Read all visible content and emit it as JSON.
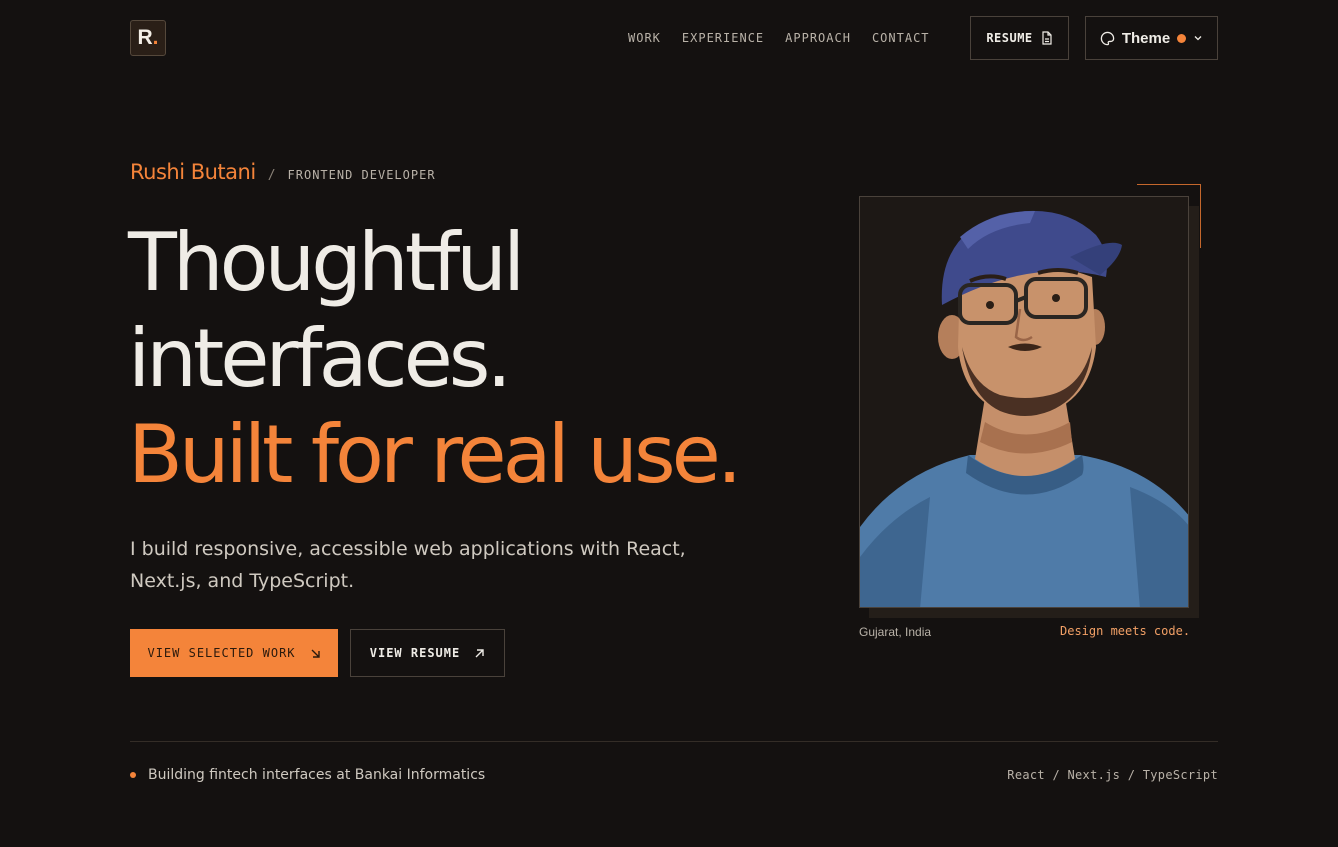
{
  "colors": {
    "accent": "#f4843a",
    "background": "#141110",
    "text": "#efece6"
  },
  "header": {
    "logo": {
      "letter": "R",
      "dot": "."
    },
    "nav": [
      {
        "label": "WORK"
      },
      {
        "label": "EXPERIENCE"
      },
      {
        "label": "APPROACH"
      },
      {
        "label": "CONTACT"
      }
    ],
    "resume_button": {
      "label": "RESUME",
      "icon": "document-icon"
    },
    "theme_button": {
      "label": "Theme",
      "icon": "palette-icon"
    }
  },
  "hero": {
    "name": "Rushi Butani",
    "separator": "/",
    "role": "FRONTEND DEVELOPER",
    "headline": {
      "line1": "Thoughtful",
      "line2": "interfaces.",
      "line3": "Built for real use."
    },
    "lede": "I build responsive, accessible web applications with React, Next.js, and TypeScript.",
    "primary_cta": {
      "label": "VIEW SELECTED WORK",
      "icon": "arrow-down-right-icon"
    },
    "secondary_cta": {
      "label": "VIEW RESUME",
      "icon": "arrow-up-right-icon"
    }
  },
  "portrait": {
    "location": "Gujarat, India",
    "tagline": "Design meets code."
  },
  "footer": {
    "status": "Building fintech interfaces at Bankai Informatics",
    "stack": "React / Next.js / TypeScript"
  }
}
